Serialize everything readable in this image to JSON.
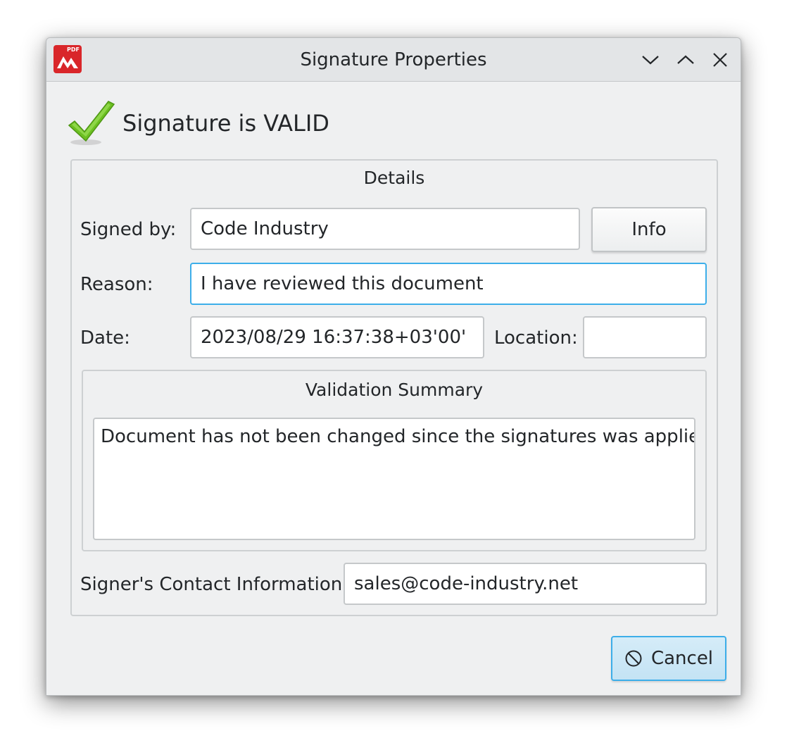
{
  "window": {
    "title": "Signature Properties",
    "app_icon_tag": "PDF"
  },
  "status": {
    "text": "Signature is VALID",
    "icon": "checkmark-icon",
    "icon_color": "#6cc021"
  },
  "details": {
    "title": "Details",
    "signed_by": {
      "label": "Signed by:",
      "value": "Code Industry"
    },
    "info_button": "Info",
    "reason": {
      "label": "Reason:",
      "value": "I have reviewed this document"
    },
    "date": {
      "label": "Date:",
      "value": "2023/08/29 16:37:38+03'00'"
    },
    "location": {
      "label": "Location:",
      "value": ""
    },
    "validation": {
      "title": "Validation Summary",
      "text": "Document has not been changed since the signatures was applied."
    },
    "contact": {
      "label": "Signer's Contact Information:",
      "value": "sales@code-industry.net"
    }
  },
  "buttons": {
    "cancel": "Cancel"
  },
  "colors": {
    "accent": "#3daee9",
    "app_brand": "#d9262a",
    "window_bg": "#eff0f1"
  }
}
